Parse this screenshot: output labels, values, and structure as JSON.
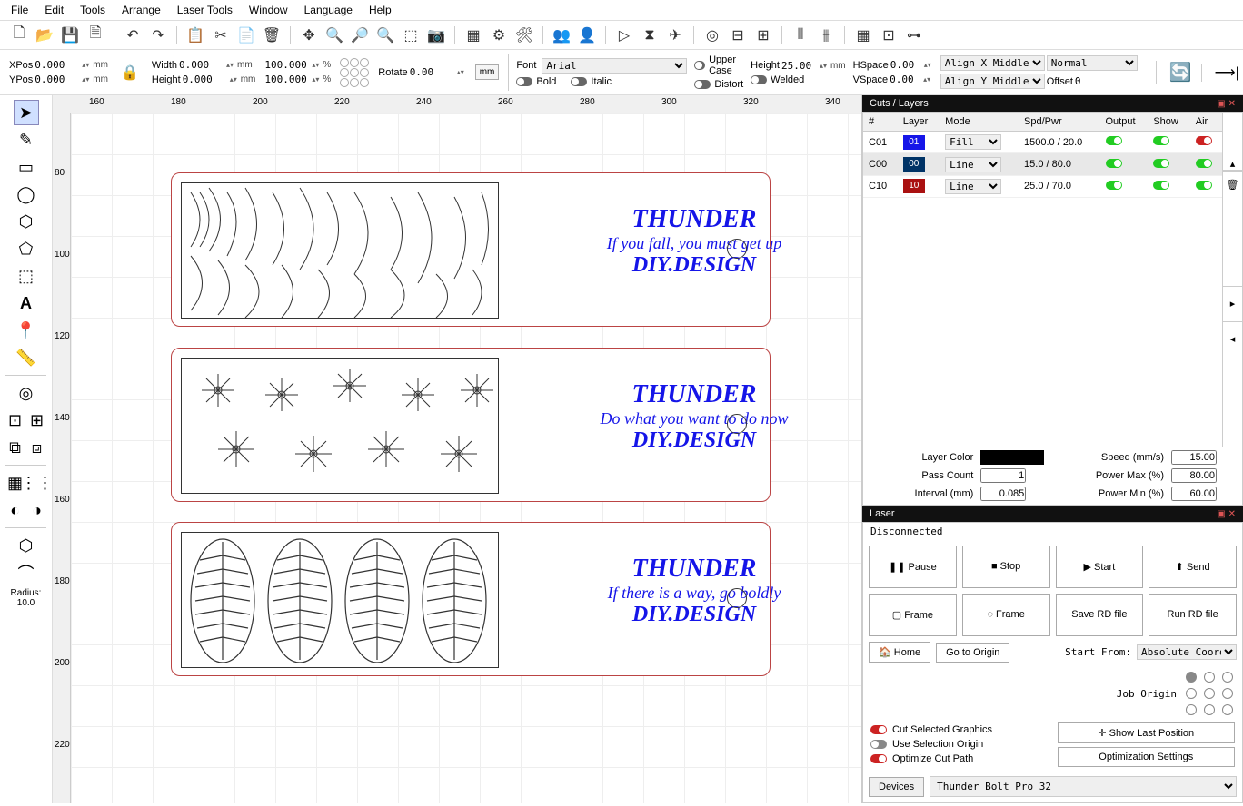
{
  "menu": [
    "File",
    "Edit",
    "Tools",
    "Arrange",
    "Laser Tools",
    "Window",
    "Language",
    "Help"
  ],
  "props": {
    "xpos_label": "XPos",
    "xpos": "0.000",
    "ypos_label": "YPos",
    "ypos": "0.000",
    "width_label": "Width",
    "width": "0.000",
    "height_label": "Height",
    "height": "0.000",
    "pct1": "100.000",
    "pct2": "100.000",
    "rotate_label": "Rotate",
    "rotate": "0.00",
    "mm": "mm",
    "pct": "%"
  },
  "font": {
    "label": "Font",
    "name": "Arial",
    "height_label": "Height",
    "height": "25.00",
    "bold": "Bold",
    "italic": "Italic",
    "upper": "Upper Case",
    "distort": "Distort",
    "welded": "Welded",
    "hspace_label": "HSpace",
    "hspace": "0.00",
    "vspace_label": "VSpace",
    "vspace": "0.00",
    "alignx": "Align X Middle",
    "aligny": "Align Y Middle",
    "normal": "Normal",
    "offset_label": "Offset",
    "offset": "0"
  },
  "ruler_h": [
    "160",
    "180",
    "200",
    "220",
    "240",
    "260",
    "280",
    "300",
    "320",
    "340"
  ],
  "ruler_v": [
    "80",
    "100",
    "120",
    "140",
    "160",
    "180",
    "200",
    "220"
  ],
  "designs": [
    {
      "title": "THUNDER",
      "quote": "If you fall, you must get up",
      "sub": "DIY.DESIGN"
    },
    {
      "title": "THUNDER",
      "quote": "Do what you want to do now",
      "sub": "DIY.DESIGN"
    },
    {
      "title": "THUNDER",
      "quote": "If there is a way, go boldly",
      "sub": "DIY.DESIGN"
    }
  ],
  "radius": {
    "label": "Radius:",
    "value": "10.0"
  },
  "cuts": {
    "title": "Cuts / Layers",
    "headers": [
      "#",
      "Layer",
      "Mode",
      "Spd/Pwr",
      "Output",
      "Show",
      "Air"
    ],
    "rows": [
      {
        "id": "C01",
        "num": "01",
        "color": "#1515e8",
        "mode": "Fill",
        "spdpwr": "1500.0 / 20.0",
        "air": "red"
      },
      {
        "id": "C00",
        "num": "00",
        "color": "#003366",
        "mode": "Line",
        "spdpwr": "15.0 / 80.0",
        "air": "on",
        "sel": true
      },
      {
        "id": "C10",
        "num": "10",
        "color": "#aa1111",
        "mode": "Line",
        "spdpwr": "25.0 / 70.0",
        "air": "on"
      }
    ],
    "layer_color_label": "Layer Color",
    "pass_count_label": "Pass Count",
    "pass_count": "1",
    "interval_label": "Interval (mm)",
    "interval": "0.085",
    "speed_label": "Speed (mm/s)",
    "speed": "15.00",
    "pmax_label": "Power Max (%)",
    "pmax": "80.00",
    "pmin_label": "Power Min (%)",
    "pmin": "60.00"
  },
  "laser": {
    "title": "Laser",
    "status": "Disconnected",
    "pause": "Pause",
    "stop": "Stop",
    "start": "Start",
    "send": "Send",
    "frame1": "Frame",
    "frame2": "Frame",
    "save_rd": "Save RD file",
    "run_rd": "Run RD file",
    "home": "Home",
    "go_origin": "Go to Origin",
    "start_from": "Start From:",
    "start_from_val": "Absolute Coords",
    "job_origin": "Job Origin",
    "cut_sel": "Cut Selected Graphics",
    "use_sel": "Use Selection Origin",
    "opt_cut": "Optimize Cut Path",
    "show_last": "Show Last Position",
    "opt_settings": "Optimization Settings",
    "devices": "Devices",
    "device_val": "Thunder Bolt Pro 32"
  }
}
